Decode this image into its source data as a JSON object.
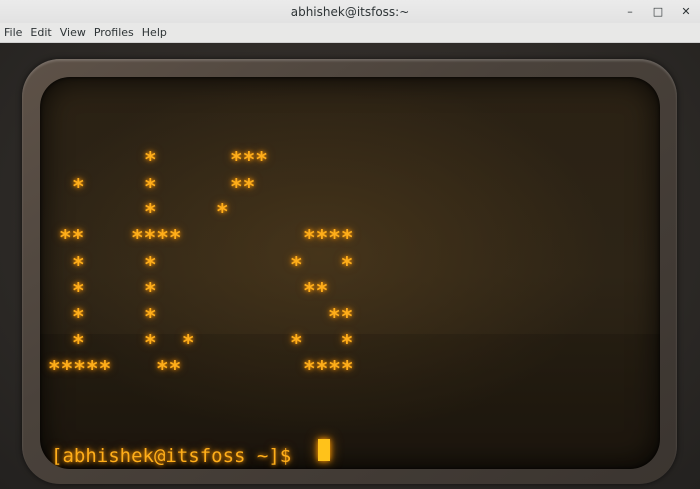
{
  "window": {
    "title": "abhishek@itsfoss:~",
    "controls": {
      "minimize": "–",
      "maximize": "□",
      "close": "✕"
    }
  },
  "menubar": {
    "items": [
      "File",
      "Edit",
      "View",
      "Profiles",
      "Help"
    ]
  },
  "terminal": {
    "art_rows": [
      {
        "col1": "",
        "col2": "*",
        "col3": "***",
        "col4": ""
      },
      {
        "col1": "*",
        "col2": "*",
        "col3": "**",
        "col4": ""
      },
      {
        "col1": "",
        "col2": "*",
        "col3": "*",
        "col4": ""
      },
      {
        "col1": "**",
        "col2": "****",
        "col3": "",
        "col4": "****"
      },
      {
        "col1": "*",
        "col2": "*",
        "col3": "",
        "col4": "*   *"
      },
      {
        "col1": "*",
        "col2": "*",
        "col3": "",
        "col4": "**"
      },
      {
        "col1": "*",
        "col2": "*",
        "col3": "",
        "col4": "**"
      },
      {
        "col1": "*",
        "col2": "*  *",
        "col3": "",
        "col4": "*   *"
      },
      {
        "col1": "*****",
        "col2": "**",
        "col3": "",
        "col4": "****"
      }
    ],
    "prompt": "[abhishek@itsfoss ~]$ "
  },
  "colors": {
    "phosphor": "#ffae1a",
    "titlebar": "#e6e6e6",
    "bezel": "#4a423b"
  }
}
